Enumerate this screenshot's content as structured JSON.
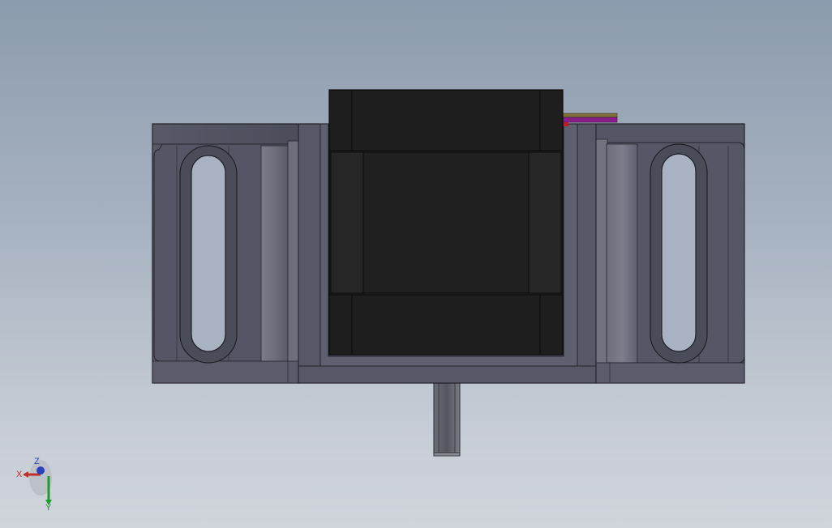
{
  "viewport": {
    "background_top": "#8c9bad",
    "background_bottom": "#d0d5dc"
  },
  "model": {
    "body_color": "#4f5160",
    "motor_color": "#1e1e1e",
    "shaft_color": "#5b5d66",
    "wire_color": "#8a1f8c"
  },
  "triad": {
    "x_label": "X",
    "y_label": "Y",
    "z_label": "Z",
    "x_color": "#c0302a",
    "y_color": "#1f9a2c",
    "z_color": "#2a3fb8"
  }
}
